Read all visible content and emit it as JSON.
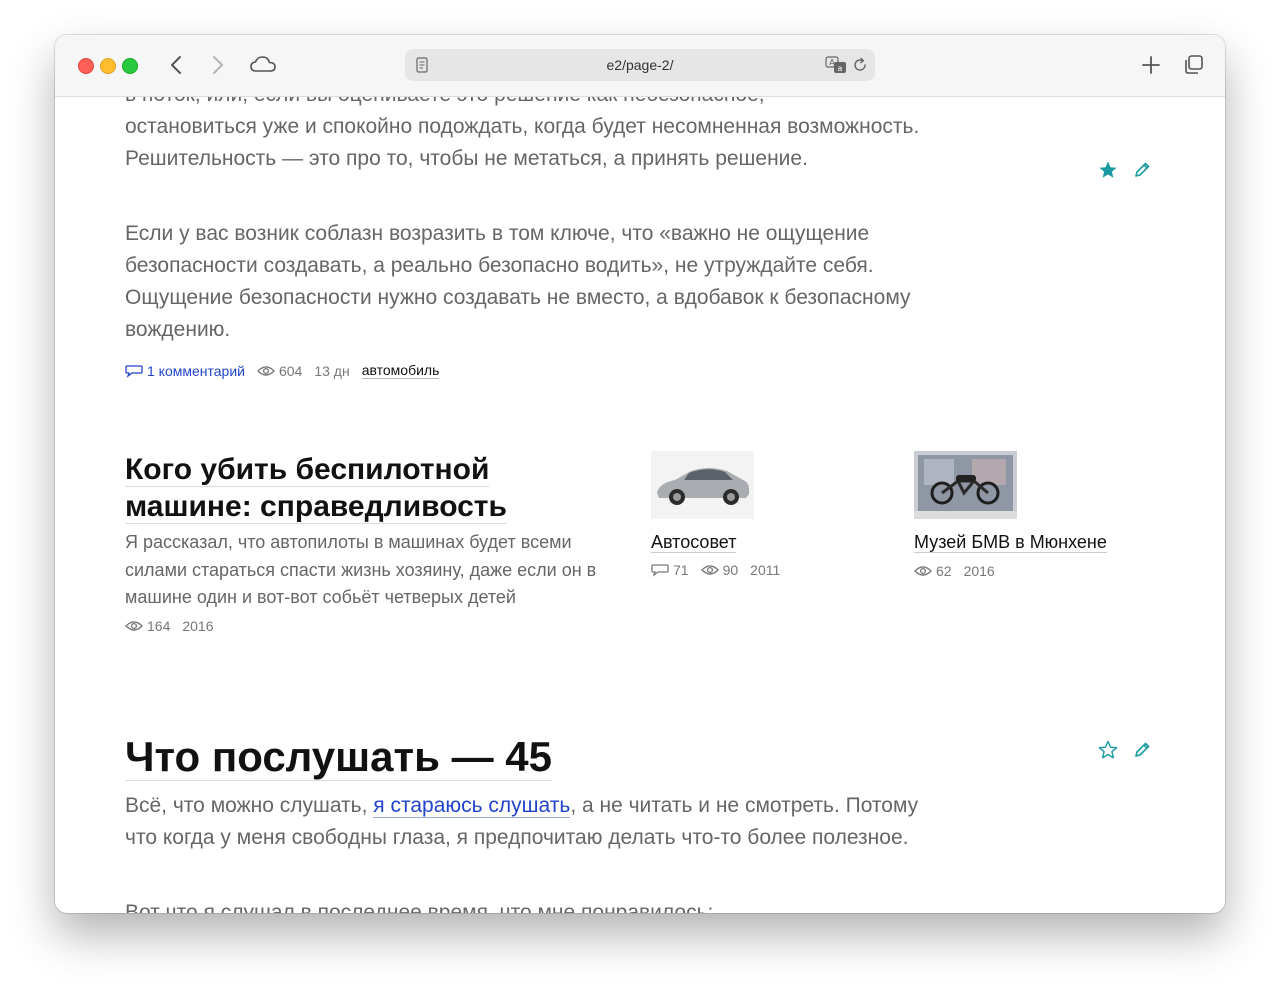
{
  "browser": {
    "address": "e2/page-2/"
  },
  "post1": {
    "partial_top_line": "в поток, или, если вы оцениваете это решение как небезопасное,",
    "para1": "остановиться уже и спокойно подождать, когда будет несомненная возможность. Решительность — это про то, чтобы не метаться, а принять решение.",
    "para2": "Если у вас возник соблазн возразить в том ключе, что «важно не ощущение безопасности создавать, а реально безопасно водить», не утруждайте себя. Ощущение безопасности нужно создавать не вместо, а вдобавок к безопасному вождению.",
    "comments_label": "1 комментарий",
    "views": "604",
    "age": "13 дн",
    "tag": "автомобиль"
  },
  "related": {
    "main": {
      "title": "Кого убить беспилотной машине: справедливость",
      "description": "Я рассказал, что автопилоты в машинах будет всеми силами стараться спасти жизнь хозяину, даже если он в машине один и вот-вот собьёт четверых детей",
      "views": "164",
      "year": "2016"
    },
    "items": [
      {
        "title": "Автосовет",
        "comments": "71",
        "views": "90",
        "year": "2011"
      },
      {
        "title": "Музей БМВ в Мюнхене",
        "views": "62",
        "year": "2016"
      }
    ]
  },
  "post2": {
    "title": "Что послушать — 45",
    "intro_before_link": "Всё, что можно слушать, ",
    "intro_link": "я стараюсь слушать",
    "intro_after_link": ", а не читать и не смотреть. Потому что когда у меня свободны глаза, я предпочитаю делать что-то более полезное.",
    "partial_bottom_line": "Вот что я слушал в последнее время, что мне понравилось:"
  },
  "colors": {
    "accent_teal": "#1a9aa0",
    "link_blue": "#2244cc",
    "text_gray": "#666666"
  },
  "icons": {
    "favorite_filled": "star-filled-icon",
    "favorite_outline": "star-outline-icon",
    "edit": "pencil-icon",
    "comments": "speech-bubble-icon",
    "views": "eye-icon"
  }
}
